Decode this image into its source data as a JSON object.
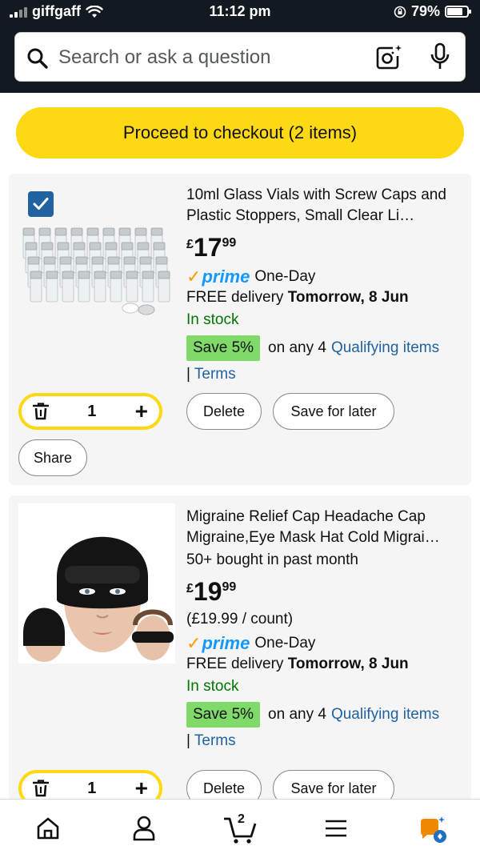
{
  "status_bar": {
    "carrier": "giffgaff",
    "time": "11:12 pm",
    "battery": "79%",
    "battery_level": 0.79
  },
  "search": {
    "placeholder": "Search or ask a question"
  },
  "checkout": {
    "label": "Proceed to checkout (2 items)"
  },
  "items": [
    {
      "title": "10ml Glass Vials with Screw Caps and Plastic Stoppers, Small Clear Li…",
      "price_currency": "£",
      "price_whole": "17",
      "price_fraction": "99",
      "prime_label": "prime",
      "prime_suffix": "One-Day",
      "delivery_prefix": "FREE delivery",
      "delivery_date": "Tomorrow, 8 Jun",
      "stock": "In stock",
      "save_badge": "Save 5%",
      "save_text": "on any 4",
      "save_link": "Qualifying items",
      "terms_prefix": "|",
      "terms_link": "Terms",
      "quantity": "1",
      "delete_label": "Delete",
      "save_later_label": "Save for later",
      "share_label": "Share"
    },
    {
      "title": "Migraine Relief Cap Headache Cap Migraine,Eye Mask Hat Cold Migrai…",
      "bought": "50+ bought in past month",
      "price_currency": "£",
      "price_whole": "19",
      "price_fraction": "99",
      "unit_price": "(£19.99 / count)",
      "prime_label": "prime",
      "prime_suffix": "One-Day",
      "delivery_prefix": "FREE delivery",
      "delivery_date": "Tomorrow, 8 Jun",
      "stock": "In stock",
      "save_badge": "Save 5%",
      "save_text": "on any 4",
      "save_link": "Qualifying items",
      "terms_prefix": "|",
      "terms_link": "Terms",
      "quantity": "1",
      "delete_label": "Delete",
      "save_later_label": "Save for later"
    }
  ],
  "bottom_nav": {
    "cart_count": "2",
    "items": [
      "home-icon",
      "account-icon",
      "cart-icon",
      "menu-icon",
      "rufus-icon"
    ]
  },
  "colors": {
    "header_bg": "#131921",
    "checkout_yellow": "#ffd814",
    "checkbox_blue": "#2162a1",
    "link_blue": "#2162a1",
    "stock_green": "#007600",
    "save_green": "#7fda69",
    "prime_blue": "#1399ff",
    "prime_orange": "#ff9900"
  }
}
